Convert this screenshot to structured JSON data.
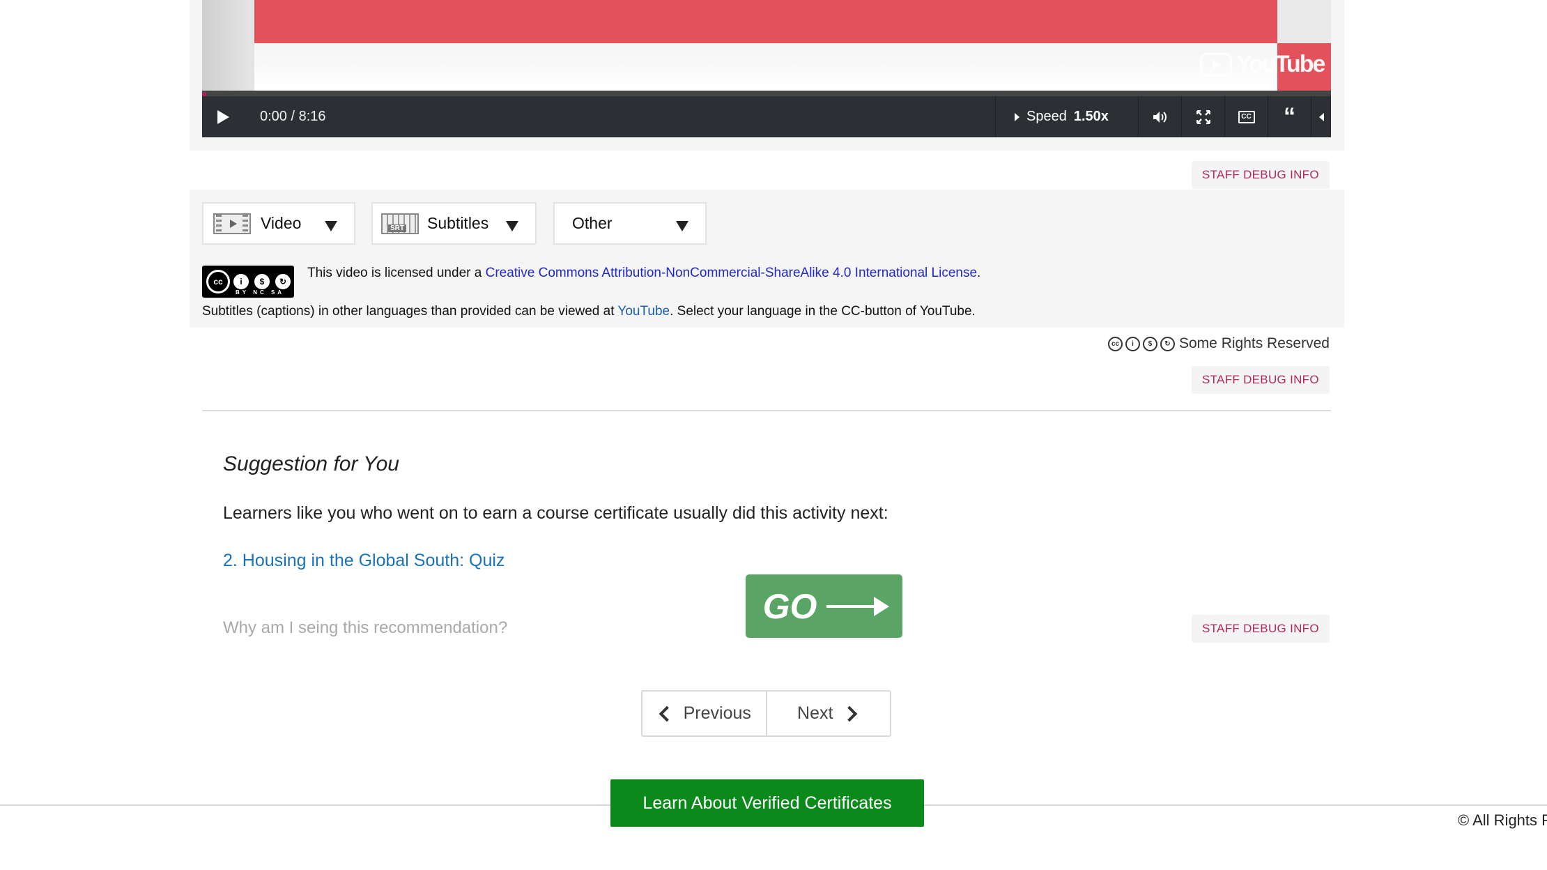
{
  "player": {
    "time": "0:00 / 8:16",
    "speed_label": "Speed",
    "speed_value": "1.50x",
    "youtube_logo": "YouTube",
    "progress": 0
  },
  "debug": {
    "label": "STAFF DEBUG INFO"
  },
  "downloads": {
    "video_label": "Video",
    "subtitles_label": "Subtitles",
    "other_label": "Other"
  },
  "license": {
    "prefix": "This video is licensed under a ",
    "link_text": "Creative Commons Attribution-NonCommercial-ShareAlike 4.0 International License",
    "suffix": ".",
    "badge_text": "BY NC SA"
  },
  "subtitles_note": {
    "prefix": "Subtitles (captions) in other languages than provided can be viewed at ",
    "link_text": "YouTube",
    "suffix": ". Select your language in the CC-button of YouTube."
  },
  "rights": {
    "text": "Some Rights Reserved"
  },
  "suggestion": {
    "title": "Suggestion for You",
    "body": "Learners like you who went on to earn a course certificate usually did this activity next:",
    "link": "2. Housing in the Global South: Quiz",
    "why": "Why am I seing this recommendation?",
    "go_label": "GO"
  },
  "pager": {
    "previous": "Previous",
    "next": "Next"
  },
  "footer": {
    "verify_button": "Learn About Verified Certificates",
    "copyright": "© All Rights R"
  }
}
